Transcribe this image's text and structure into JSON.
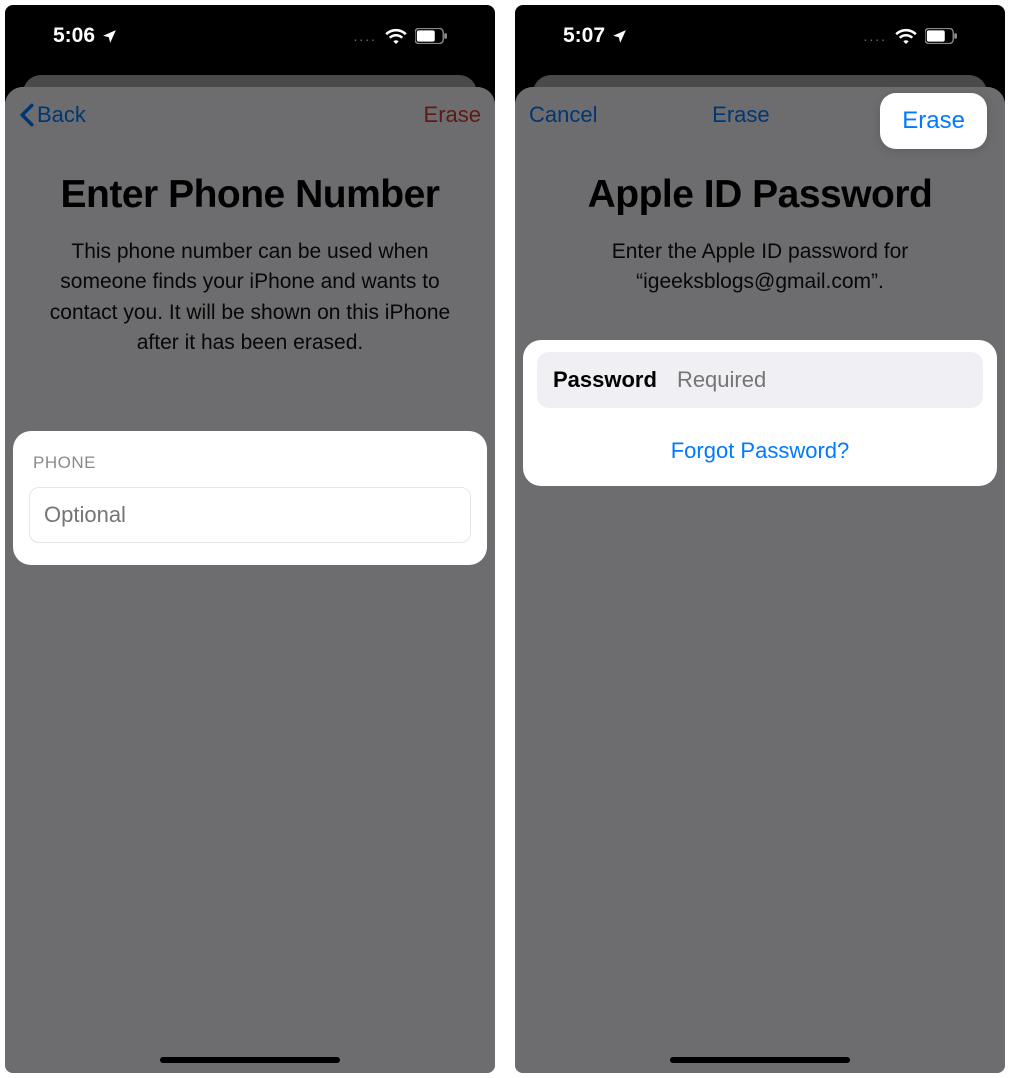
{
  "left": {
    "status_time": "5:06",
    "nav_back": "Back",
    "nav_erase": "Erase",
    "title": "Enter Phone Number",
    "subtitle": "This phone number can be used when someone finds your iPhone and wants to contact you. It will be shown on this iPhone after it has been erased.",
    "phone_section_label": "PHONE",
    "phone_placeholder": "Optional"
  },
  "right": {
    "status_time": "5:07",
    "nav_cancel": "Cancel",
    "nav_erase": "Erase",
    "title": "Apple ID Password",
    "subtitle": "Enter the Apple ID password for “igeeksblogs@gmail.com”.",
    "password_label": "Password",
    "password_placeholder": "Required",
    "forgot_label": "Forgot Password?"
  }
}
